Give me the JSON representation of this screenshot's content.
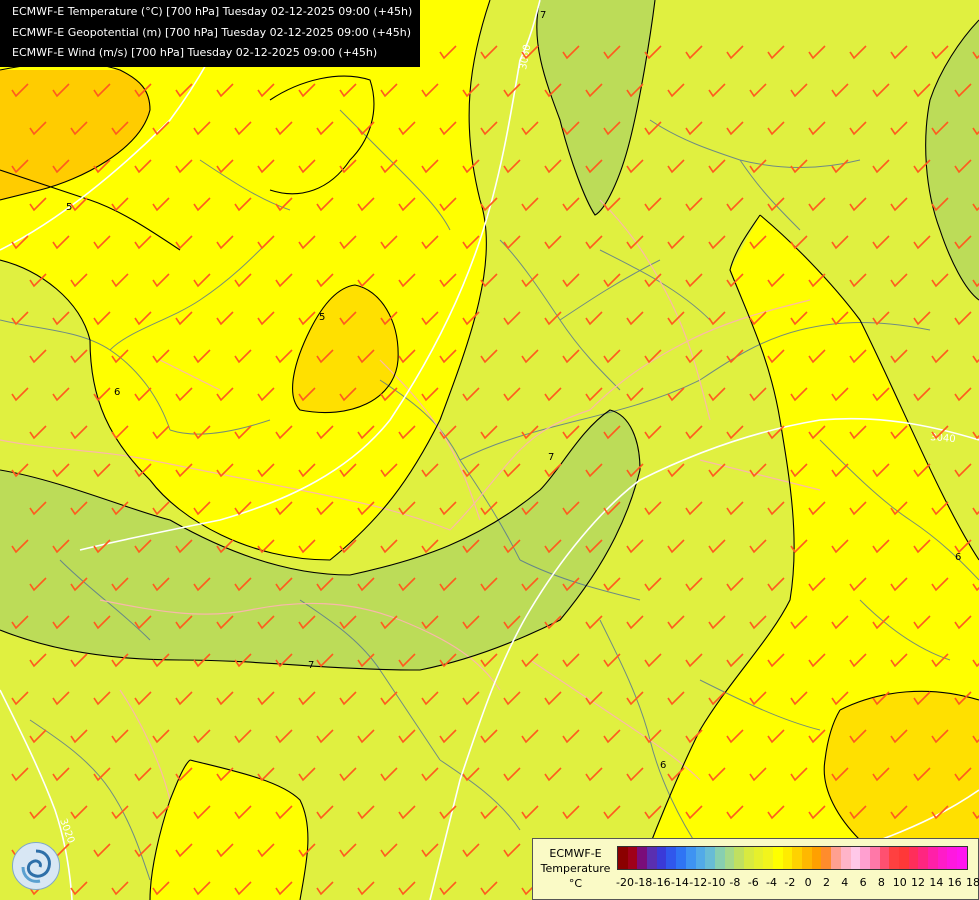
{
  "header": {
    "line1": "ECMWF-E Temperature (°C) [700 hPa] Tuesday 02-12-2025 09:00 (+45h)",
    "line2": "ECMWF-E Geopotential (m) [700 hPa] Tuesday 02-12-2025 09:00 (+45h)",
    "line3": "ECMWF-E Wind (m/s) [700 hPa] Tuesday 02-12-2025 09:00 (+45h)"
  },
  "contour_labels": {
    "isotherm_5a": "5",
    "isotherm_5b": "5",
    "isotherm_6a": "6",
    "isotherm_6b": "6",
    "isotherm_6c": "6",
    "isotherm_7a": "7",
    "isotherm_7b": "7",
    "isotherm_7c": "7",
    "geopot_3020": "3020",
    "geopot_3040": "3040",
    "geopot_3060": "3060"
  },
  "legend": {
    "title_line1": "ECMWF-E",
    "title_line2": "Temperature",
    "title_line3": "°C",
    "ticks": [
      "-20",
      "-18",
      "-16",
      "-14",
      "-12",
      "-10",
      "-8",
      "-6",
      "-4",
      "-2",
      "0",
      "2",
      "4",
      "6",
      "8",
      "10",
      "12",
      "14",
      "16",
      "18"
    ],
    "colors": [
      "#8b0000",
      "#a0001a",
      "#7a0d7a",
      "#5a2fb0",
      "#3a3ad8",
      "#3057ec",
      "#2f74f4",
      "#3e93f2",
      "#52aae8",
      "#68bcd6",
      "#88cfb0",
      "#a5d98a",
      "#c0e060",
      "#d8ea40",
      "#e6f02c",
      "#f2f41c",
      "#ffff00",
      "#ffec00",
      "#ffd200",
      "#ffb800",
      "#ffa000",
      "#ff8c2c",
      "#ffa090",
      "#ffb4c8",
      "#ffc8e8",
      "#ffa0d0",
      "#ff78a8",
      "#ff5070",
      "#ff4040",
      "#ff3838",
      "#ff2e5a",
      "#ff2680",
      "#ff20a8",
      "#ff1cc8",
      "#ff18e0",
      "#ff16f0"
    ]
  },
  "colors": {
    "yellow": "#ffff00",
    "yellow_green": "#e0f040",
    "green": "#bcdc58",
    "orange": "#ffd200",
    "wind_barb": "#ff5a1e",
    "isotherm": "#000000",
    "geopotential": "#ffffff",
    "rivers": "#4a6a9a",
    "borders": "#ffb4b4"
  },
  "icons": {
    "logo": "ecmwf-logo-icon"
  }
}
